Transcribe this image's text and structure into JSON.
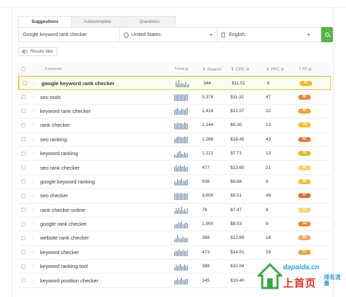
{
  "tabs": [
    {
      "label": "Suggestions",
      "active": true
    },
    {
      "label": "Autocomplete",
      "active": false
    },
    {
      "label": "Questions",
      "active": false
    }
  ],
  "search": {
    "keyword": "Google keyword rank checker",
    "country": "United States",
    "language": "English"
  },
  "filter_label": "Results filter",
  "table": {
    "headers": {
      "keywords": "Keywords",
      "trend": "Trend",
      "search": "Search",
      "cpc": "CPC",
      "ppc": "PPC",
      "kd": "KD"
    },
    "rows": [
      {
        "keyword": "google keyword rank checker",
        "search": "344",
        "cpc": "$11.51",
        "ppc": "6",
        "kd": "45",
        "kd_color": "#f0b81e",
        "trend": [
          0.8,
          0.5,
          1,
          0.4,
          0.6,
          0.5,
          0.4,
          0.7,
          0.3,
          0.5
        ]
      },
      {
        "keyword": "seo tools",
        "search": "5,378",
        "cpc": "$11.32",
        "ppc": "47",
        "kd": "66",
        "kd_color": "#e8823a",
        "trend": [
          1,
          0.9,
          1,
          0.95,
          0.9,
          1,
          0.95,
          0.9,
          1,
          0.95
        ]
      },
      {
        "keyword": "keyword rank checker",
        "search": "1,416",
        "cpc": "$12.07",
        "ppc": "22",
        "kd": "47",
        "kd_color": "#eda22a",
        "trend": [
          0.7,
          0.9,
          1,
          0.8,
          0.6,
          0.9,
          0.8,
          0.7,
          0.9,
          1
        ]
      },
      {
        "keyword": "rank checker",
        "search": "1,144",
        "cpc": "$9.30",
        "ppc": "13",
        "kd": "44",
        "kd_color": "#f2bf2a",
        "trend": [
          0.9,
          0.8,
          1,
          0.9,
          0.85,
          0.9,
          0.8,
          0.95,
          0.9,
          0.85
        ]
      },
      {
        "keyword": "seo ranking",
        "search": "1,286",
        "cpc": "$18.45",
        "ppc": "43",
        "kd": "62",
        "kd_color": "#e47a35",
        "trend": [
          0.6,
          0.8,
          0.9,
          1,
          0.85,
          0.8,
          0.9,
          0.95,
          0.9,
          1
        ]
      },
      {
        "keyword": "keyword ranking",
        "search": "1,121",
        "cpc": "$7.71",
        "ppc": "13",
        "kd": "50",
        "kd_color": "#eeb02a",
        "trend": [
          0.5,
          0.4,
          0.7,
          0.9,
          1,
          0.6,
          0.5,
          0.8,
          0.6,
          0.7
        ]
      },
      {
        "keyword": "seo rank checker",
        "search": "477",
        "cpc": "$13.65",
        "ppc": "21",
        "kd": "40",
        "kd_color": "#f4d16a",
        "trend": [
          0.7,
          1,
          0.6,
          0.8,
          0.9,
          0.7,
          0.8,
          0.9,
          0.6,
          0.7
        ]
      },
      {
        "keyword": "google keyword ranking",
        "search": "936",
        "cpc": "$8.66",
        "ppc": "8",
        "kd": "46",
        "kd_color": "#f0c03a",
        "trend": [
          0.6,
          0.5,
          0.9,
          0.7,
          0.8,
          1,
          0.7,
          0.6,
          0.8,
          0.9
        ]
      },
      {
        "keyword": "seo checker",
        "search": "3,600",
        "cpc": "$9.51",
        "ppc": "49",
        "kd": "67",
        "kd_color": "#df6b33",
        "trend": [
          0.9,
          1,
          0.95,
          0.9,
          1,
          0.95,
          0.9,
          1,
          0.9,
          0.95
        ]
      },
      {
        "keyword": "rank checker online",
        "search": "76",
        "cpc": "$7.47",
        "ppc": "8",
        "kd": "47",
        "kd_color": "#f5d27c",
        "trend": [
          0.4,
          0.8,
          0.5,
          0.9,
          0.6,
          1,
          0.5,
          0.7,
          0.4,
          0.8
        ]
      },
      {
        "keyword": "google rank checker",
        "search": "1,900",
        "cpc": "$8.03",
        "ppc": "9",
        "kd": "54",
        "kd_color": "#e98a2c",
        "trend": [
          0.5,
          0.7,
          0.6,
          0.9,
          0.8,
          1,
          0.6,
          0.7,
          0.9,
          0.8
        ]
      },
      {
        "keyword": "website rank checker",
        "search": "369",
        "cpc": "$12.69",
        "ppc": "18",
        "kd": "83",
        "kd_color": "#f0a766",
        "trend": [
          0.4,
          0.6,
          1,
          0.7,
          0.5,
          0.6,
          0.8,
          0.5,
          0.7,
          0.6
        ]
      },
      {
        "keyword": "keyword checker",
        "search": "473",
        "cpc": "$14.01",
        "ppc": "19",
        "kd": "51",
        "kd_color": "#e9a22c",
        "trend": [
          0.6,
          0.8,
          0.7,
          1,
          0.8,
          0.7,
          0.9,
          0.8,
          0.7,
          0.9
        ]
      },
      {
        "keyword": "keyword ranking tool",
        "search": "388",
        "cpc": "$10.04",
        "ppc": "",
        "kd": "",
        "kd_color": "#f0b81e",
        "trend": [
          0.5,
          0.9,
          0.6,
          0.8,
          1,
          0.7,
          0.6,
          0.9,
          0.7,
          0.8
        ]
      },
      {
        "keyword": "keyword position checker",
        "search": "145",
        "cpc": "$19.40",
        "ppc": "",
        "kd": "",
        "kd_color": "#f0b81e",
        "trend": [
          0.6,
          0.7,
          0.9,
          0.6,
          0.8,
          1,
          0.7,
          0.6,
          0.8,
          0.9
        ]
      }
    ]
  },
  "watermark": {
    "url": "dapaida.cn",
    "cn": "上首页",
    "rank": "排名流量"
  }
}
